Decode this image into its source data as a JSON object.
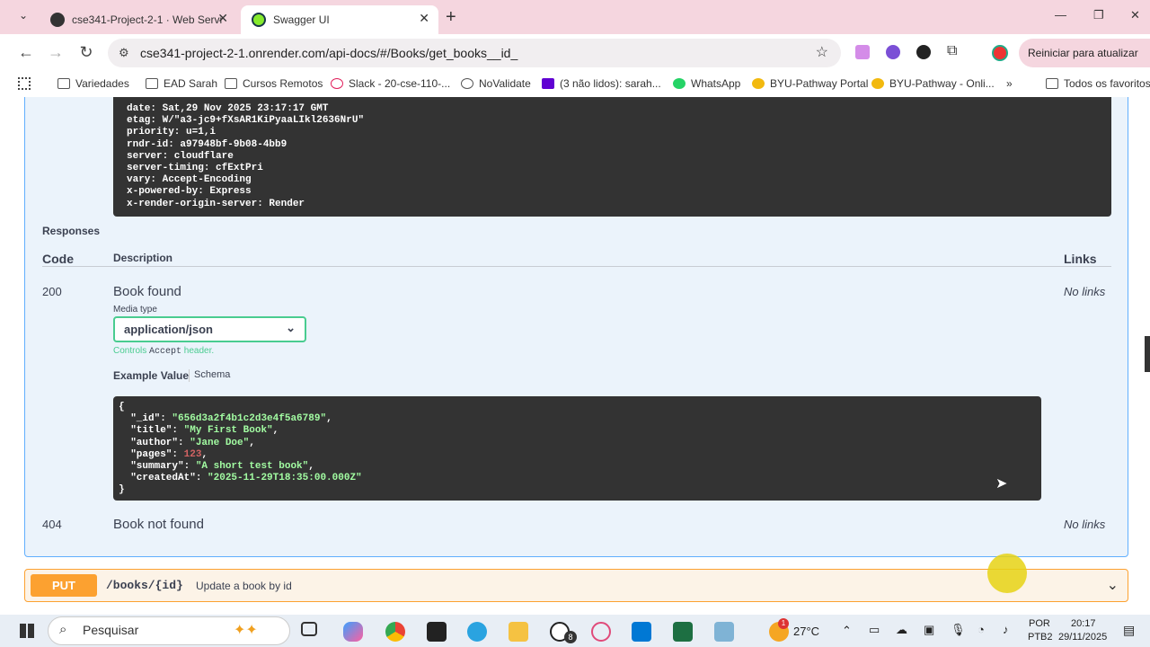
{
  "browser": {
    "tabs": [
      {
        "title": "cse341-Project-2-1 · Web Servi",
        "active": false
      },
      {
        "title": "Swagger UI",
        "active": true
      }
    ],
    "new_tab": "+",
    "url": "cse341-project-2-1.onrender.com/api-docs/#/Books/get_books__id_",
    "update_button": "Reiniciar para atualizar",
    "window_controls": [
      "—",
      "❐",
      "✕"
    ],
    "bookmarks": [
      "Variedades",
      "EAD Sarah",
      "Cursos Remotos",
      "Slack - 20-cse-110-...",
      "NoValidate",
      "(3 não lidos): sarah...",
      "WhatsApp",
      "BYU-Pathway Portal",
      "BYU-Pathway - Onli...",
      "»",
      "Todos os favoritos"
    ]
  },
  "headers_block": [
    "date: Sat,29 Nov 2025 23:17:17 GMT",
    "etag: W/\"a3-jc9+fXsAR1KiPyaaLIkl2636NrU\"",
    "priority: u=1,i",
    "rndr-id: a97948bf-9b08-4bb9",
    "server: cloudflare",
    "server-timing: cfExtPri",
    "vary: Accept-Encoding",
    "x-powered-by: Express",
    "x-render-origin-server: Render"
  ],
  "responses": {
    "title": "Responses",
    "col_code": "Code",
    "col_description": "Description",
    "col_links": "Links",
    "rows": [
      {
        "code": "200",
        "description": "Book found",
        "links": "No links"
      },
      {
        "code": "404",
        "description": "Book not found",
        "links": "No links"
      }
    ],
    "media_type_label": "Media type",
    "media_type_value": "application/json",
    "controls_prefix": "Controls ",
    "controls_code": "Accept",
    "controls_suffix": " header.",
    "example_tab": "Example Value",
    "schema_tab": "Schema",
    "example": {
      "_id": "\"656d3a2f4b1c2d3e4f5a6789\"",
      "title": "\"My First Book\"",
      "author": "\"Jane Doe\"",
      "pages": "123",
      "summary": "\"A short test book\"",
      "createdAt": "\"2025-11-29T18:35:00.000Z\""
    }
  },
  "put_op": {
    "method": "PUT",
    "path": "/books/{id}",
    "summary": "Update a book by id"
  },
  "taskbar": {
    "search_placeholder": "Pesquisar",
    "weather": "27°C",
    "lang1": "POR",
    "lang2": "PTB2",
    "time": "20:17",
    "date": "29/11/2025",
    "whatsapp_badge": "8",
    "weather_badge": "1"
  },
  "colors": {
    "get_green": "#49cc90",
    "put_orange": "#fca130",
    "swagger_blue": "#61affe",
    "tab_bar_pink": "#f5d6df"
  }
}
